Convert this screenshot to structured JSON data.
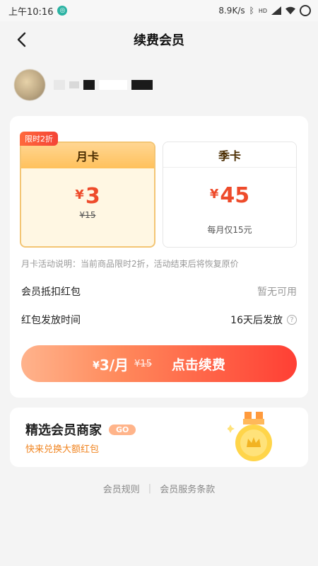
{
  "status_bar": {
    "time": "上午10:16",
    "speed": "8.9K/s",
    "network": "HD"
  },
  "nav": {
    "title": "续费会员"
  },
  "plans": [
    {
      "name": "月卡",
      "currency": "¥",
      "price": "3",
      "original": "¥15",
      "badge": "限时2折",
      "selected": true
    },
    {
      "name": "季卡",
      "currency": "¥",
      "price": "45",
      "subtitle": "每月仅15元",
      "selected": false
    }
  ],
  "note": "月卡活动说明：当前商品限时2折，活动结束后将恢复原价",
  "rows": {
    "red_packet_label": "会员抵扣红包",
    "red_packet_value": "暂无可用",
    "release_label": "红包发放时间",
    "release_value": "16天后发放"
  },
  "cta": {
    "currency": "¥",
    "price": "3",
    "unit": "/月",
    "original": "¥15",
    "text": "点击续费"
  },
  "promo": {
    "title": "精选会员商家",
    "go_label": "GO",
    "subtitle": "快来兑换大额红包"
  },
  "footer": {
    "rules": "会员规则",
    "separator": "|",
    "terms": "会员服务条款"
  },
  "colors": {
    "accent_red": "#ee4b2b",
    "gold": "#ffc15c",
    "orange_text": "#f08420"
  }
}
